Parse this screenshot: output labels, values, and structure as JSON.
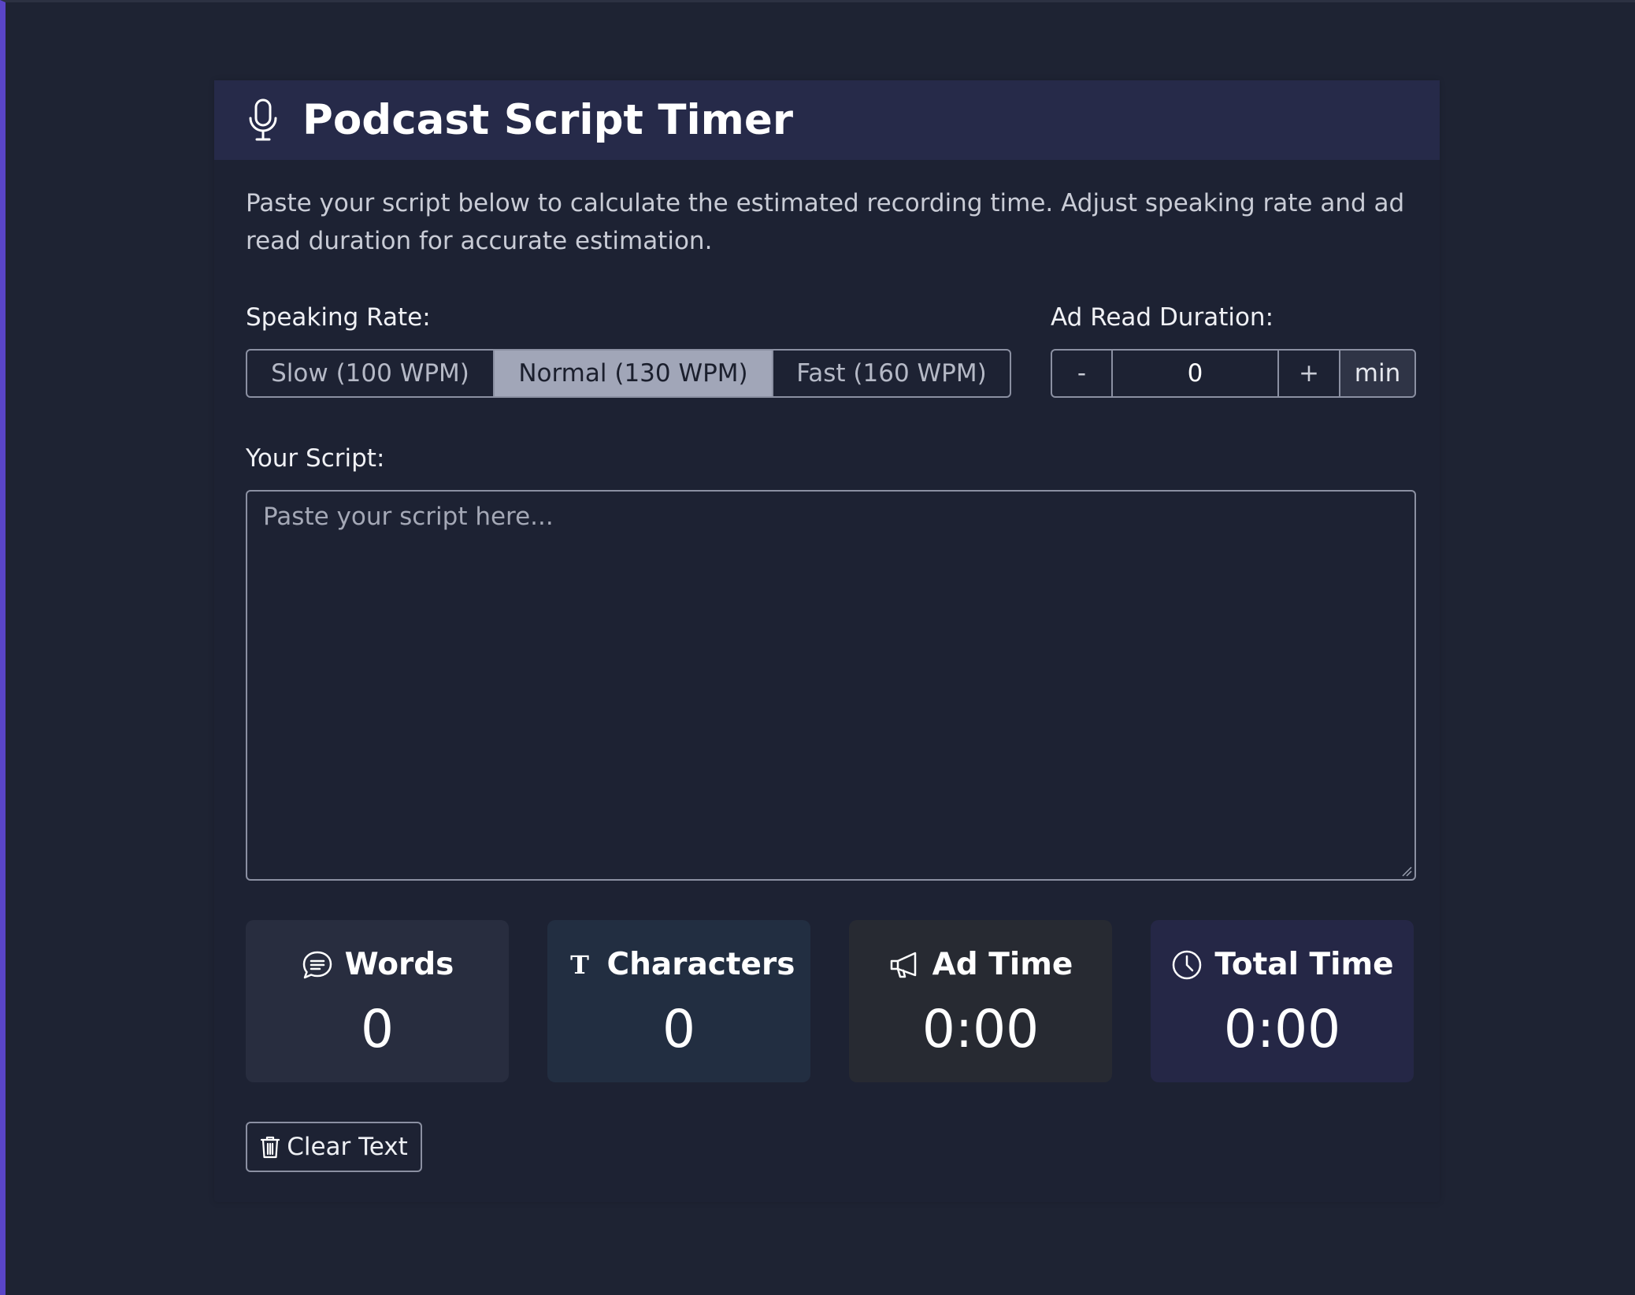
{
  "header": {
    "title": "Podcast Script Timer",
    "icon": "microphone-icon"
  },
  "description": "Paste your script below to calculate the estimated recording time. Adjust speaking rate and ad read duration for accurate estimation.",
  "speaking_rate": {
    "label": "Speaking Rate:",
    "options": [
      "Slow (100 WPM)",
      "Normal (130 WPM)",
      "Fast (160 WPM)"
    ],
    "selected": "Normal (130 WPM)"
  },
  "ad_read": {
    "label": "Ad Read Duration:",
    "minus": "-",
    "value": "0",
    "plus": "+",
    "unit": "min"
  },
  "script": {
    "label": "Your Script:",
    "placeholder": "Paste your script here...",
    "value": ""
  },
  "stats": {
    "words": {
      "label": "Words",
      "value": "0",
      "icon": "speech-bubble-icon"
    },
    "characters": {
      "label": "Characters",
      "value": "0",
      "icon": "text-icon"
    },
    "ad_time": {
      "label": "Ad Time",
      "value": "0:00",
      "icon": "megaphone-icon"
    },
    "total_time": {
      "label": "Total Time",
      "value": "0:00",
      "icon": "clock-icon"
    }
  },
  "clear_button": {
    "label": "Clear Text",
    "icon": "trash-icon"
  },
  "colors": {
    "background": "#1e2333",
    "header": "#262a49",
    "accent_border": "#5a45c8",
    "selected_option": "#a1a6b8"
  }
}
